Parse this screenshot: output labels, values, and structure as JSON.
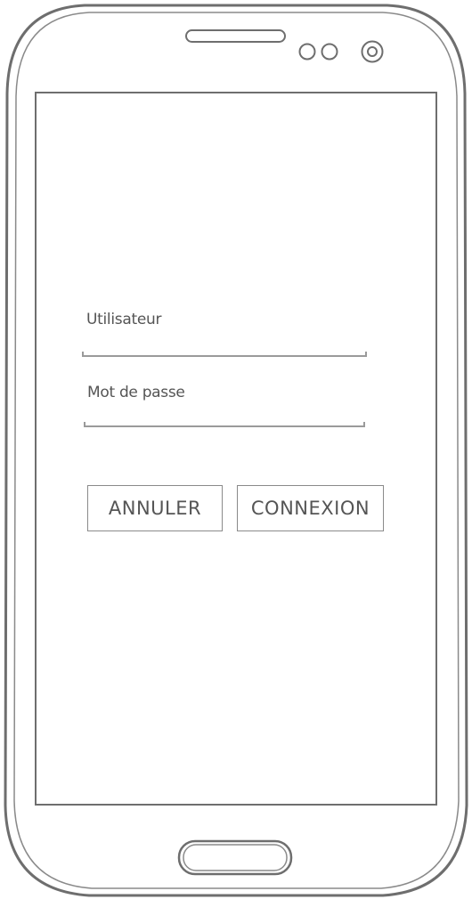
{
  "login_form": {
    "username_label": "Utilisateur",
    "password_label": "Mot de passe",
    "cancel_label": "ANNULER",
    "connect_label": "CONNEXION"
  },
  "colors": {
    "stroke": "#6e6e6e",
    "text": "#555555",
    "background": "#ffffff"
  }
}
